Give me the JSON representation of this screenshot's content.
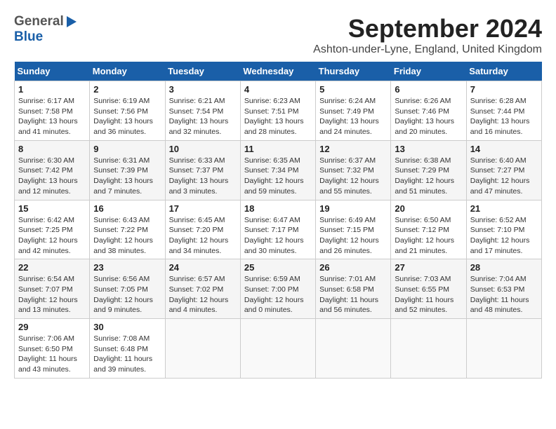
{
  "header": {
    "logo_line1": "General",
    "logo_line2": "Blue",
    "month_title": "September 2024",
    "subtitle": "Ashton-under-Lyne, England, United Kingdom"
  },
  "columns": [
    "Sunday",
    "Monday",
    "Tuesday",
    "Wednesday",
    "Thursday",
    "Friday",
    "Saturday"
  ],
  "weeks": [
    [
      {
        "day": "1",
        "info": "Sunrise: 6:17 AM\nSunset: 7:58 PM\nDaylight: 13 hours\nand 41 minutes."
      },
      {
        "day": "2",
        "info": "Sunrise: 6:19 AM\nSunset: 7:56 PM\nDaylight: 13 hours\nand 36 minutes."
      },
      {
        "day": "3",
        "info": "Sunrise: 6:21 AM\nSunset: 7:54 PM\nDaylight: 13 hours\nand 32 minutes."
      },
      {
        "day": "4",
        "info": "Sunrise: 6:23 AM\nSunset: 7:51 PM\nDaylight: 13 hours\nand 28 minutes."
      },
      {
        "day": "5",
        "info": "Sunrise: 6:24 AM\nSunset: 7:49 PM\nDaylight: 13 hours\nand 24 minutes."
      },
      {
        "day": "6",
        "info": "Sunrise: 6:26 AM\nSunset: 7:46 PM\nDaylight: 13 hours\nand 20 minutes."
      },
      {
        "day": "7",
        "info": "Sunrise: 6:28 AM\nSunset: 7:44 PM\nDaylight: 13 hours\nand 16 minutes."
      }
    ],
    [
      {
        "day": "8",
        "info": "Sunrise: 6:30 AM\nSunset: 7:42 PM\nDaylight: 13 hours\nand 12 minutes."
      },
      {
        "day": "9",
        "info": "Sunrise: 6:31 AM\nSunset: 7:39 PM\nDaylight: 13 hours\nand 7 minutes."
      },
      {
        "day": "10",
        "info": "Sunrise: 6:33 AM\nSunset: 7:37 PM\nDaylight: 13 hours\nand 3 minutes."
      },
      {
        "day": "11",
        "info": "Sunrise: 6:35 AM\nSunset: 7:34 PM\nDaylight: 12 hours\nand 59 minutes."
      },
      {
        "day": "12",
        "info": "Sunrise: 6:37 AM\nSunset: 7:32 PM\nDaylight: 12 hours\nand 55 minutes."
      },
      {
        "day": "13",
        "info": "Sunrise: 6:38 AM\nSunset: 7:29 PM\nDaylight: 12 hours\nand 51 minutes."
      },
      {
        "day": "14",
        "info": "Sunrise: 6:40 AM\nSunset: 7:27 PM\nDaylight: 12 hours\nand 47 minutes."
      }
    ],
    [
      {
        "day": "15",
        "info": "Sunrise: 6:42 AM\nSunset: 7:25 PM\nDaylight: 12 hours\nand 42 minutes."
      },
      {
        "day": "16",
        "info": "Sunrise: 6:43 AM\nSunset: 7:22 PM\nDaylight: 12 hours\nand 38 minutes."
      },
      {
        "day": "17",
        "info": "Sunrise: 6:45 AM\nSunset: 7:20 PM\nDaylight: 12 hours\nand 34 minutes."
      },
      {
        "day": "18",
        "info": "Sunrise: 6:47 AM\nSunset: 7:17 PM\nDaylight: 12 hours\nand 30 minutes."
      },
      {
        "day": "19",
        "info": "Sunrise: 6:49 AM\nSunset: 7:15 PM\nDaylight: 12 hours\nand 26 minutes."
      },
      {
        "day": "20",
        "info": "Sunrise: 6:50 AM\nSunset: 7:12 PM\nDaylight: 12 hours\nand 21 minutes."
      },
      {
        "day": "21",
        "info": "Sunrise: 6:52 AM\nSunset: 7:10 PM\nDaylight: 12 hours\nand 17 minutes."
      }
    ],
    [
      {
        "day": "22",
        "info": "Sunrise: 6:54 AM\nSunset: 7:07 PM\nDaylight: 12 hours\nand 13 minutes."
      },
      {
        "day": "23",
        "info": "Sunrise: 6:56 AM\nSunset: 7:05 PM\nDaylight: 12 hours\nand 9 minutes."
      },
      {
        "day": "24",
        "info": "Sunrise: 6:57 AM\nSunset: 7:02 PM\nDaylight: 12 hours\nand 4 minutes."
      },
      {
        "day": "25",
        "info": "Sunrise: 6:59 AM\nSunset: 7:00 PM\nDaylight: 12 hours\nand 0 minutes."
      },
      {
        "day": "26",
        "info": "Sunrise: 7:01 AM\nSunset: 6:58 PM\nDaylight: 11 hours\nand 56 minutes."
      },
      {
        "day": "27",
        "info": "Sunrise: 7:03 AM\nSunset: 6:55 PM\nDaylight: 11 hours\nand 52 minutes."
      },
      {
        "day": "28",
        "info": "Sunrise: 7:04 AM\nSunset: 6:53 PM\nDaylight: 11 hours\nand 48 minutes."
      }
    ],
    [
      {
        "day": "29",
        "info": "Sunrise: 7:06 AM\nSunset: 6:50 PM\nDaylight: 11 hours\nand 43 minutes."
      },
      {
        "day": "30",
        "info": "Sunrise: 7:08 AM\nSunset: 6:48 PM\nDaylight: 11 hours\nand 39 minutes."
      },
      {
        "day": "",
        "info": ""
      },
      {
        "day": "",
        "info": ""
      },
      {
        "day": "",
        "info": ""
      },
      {
        "day": "",
        "info": ""
      },
      {
        "day": "",
        "info": ""
      }
    ]
  ]
}
